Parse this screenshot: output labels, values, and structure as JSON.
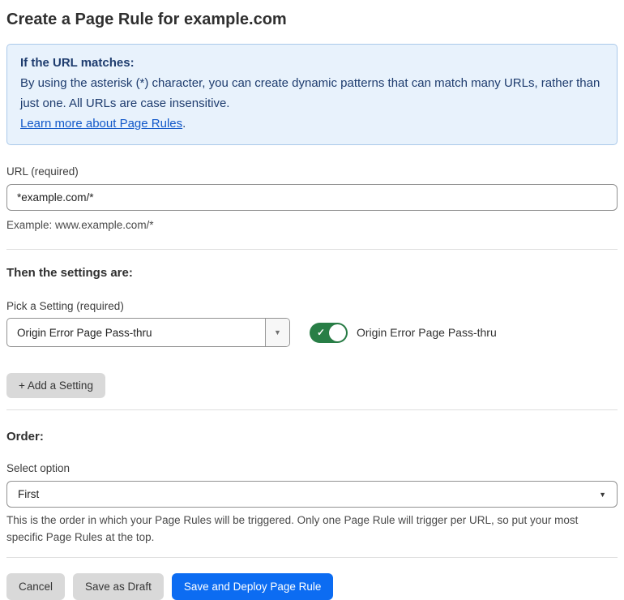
{
  "page": {
    "title": "Create a Page Rule for example.com"
  },
  "info_box": {
    "heading": "If the URL matches:",
    "body": "By using the asterisk (*) character, you can create dynamic patterns that can match many URLs, rather than just one. All URLs are case insensitive.",
    "link": "Learn more about Page Rules",
    "link_suffix": "."
  },
  "url_field": {
    "label": "URL (required)",
    "value": "*example.com/*",
    "example": "Example: www.example.com/*"
  },
  "settings": {
    "heading": "Then the settings are:",
    "pick_label": "Pick a Setting (required)",
    "selected_setting": "Origin Error Page Pass-thru",
    "toggle_label": "Origin Error Page Pass-thru",
    "toggle_state": "on",
    "add_button_label": "+ Add a Setting"
  },
  "order": {
    "heading": "Order:",
    "label": "Select option",
    "selected_option": "First",
    "help": "This is the order in which your Page Rules will be triggered. Only one Page Rule will trigger per URL, so put your most specific Page Rules at the top."
  },
  "footer": {
    "cancel_label": "Cancel",
    "save_draft_label": "Save as Draft",
    "save_deploy_label": "Save and Deploy Page Rule"
  },
  "icons": {
    "chevron_down": "▼",
    "check": "✓"
  },
  "colors": {
    "accent_blue": "#0c6cf2",
    "toggle_green": "#287e46",
    "info_bg": "#e8f2fc",
    "info_border": "#abc9ea",
    "info_text": "#1e3c6e",
    "link_blue": "#1158c9",
    "button_gray": "#d9d9d9"
  }
}
